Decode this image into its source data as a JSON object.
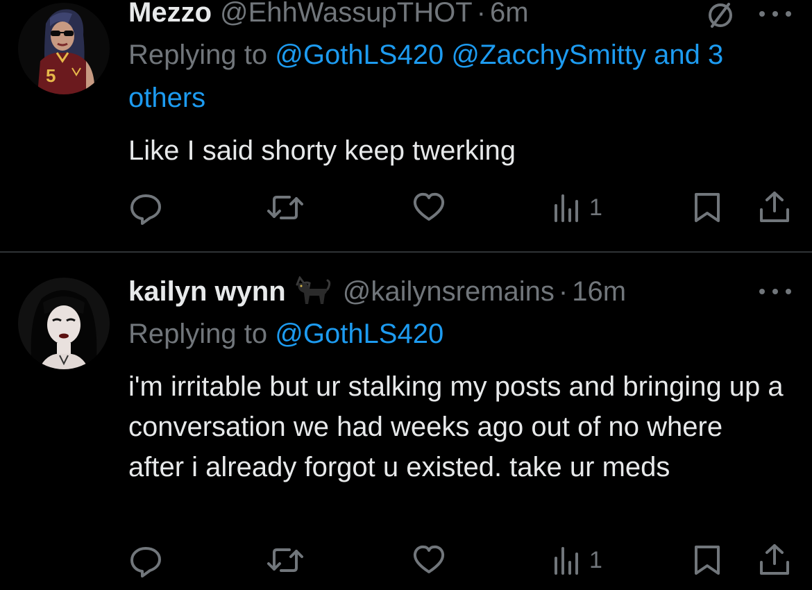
{
  "tweets": [
    {
      "display_name": "Mezzo",
      "handle": "@EhhWassupTHOT",
      "separator": "·",
      "time": "6m",
      "replying_prefix": "Replying to ",
      "replying_mentions": "@GothLS420 @ZacchySmitty and 3 others",
      "text": "Like I said shorty keep twerking",
      "views": "1",
      "avatar_icon": "avatar-mezzo",
      "header_icons": [
        "grok-icon",
        "more-icon"
      ]
    },
    {
      "display_name": "kailyn wynn",
      "name_emoji": "black-cat-emoji",
      "handle": "@kailynsremains",
      "separator": "·",
      "time": "16m",
      "replying_prefix": "Replying to ",
      "replying_mentions": "@GothLS420",
      "text": "i'm irritable but ur stalking my posts and bringing up a conversation we had weeks ago out of no where after i already forgot u existed. take ur meds",
      "views": "1",
      "avatar_icon": "avatar-kailyn",
      "header_icons": [
        "more-icon"
      ]
    }
  ],
  "colors": {
    "background": "#000000",
    "primary_text": "#e7e9ea",
    "secondary_text": "#71767b",
    "mention": "#1d9bf0",
    "divider": "#2f3336"
  }
}
